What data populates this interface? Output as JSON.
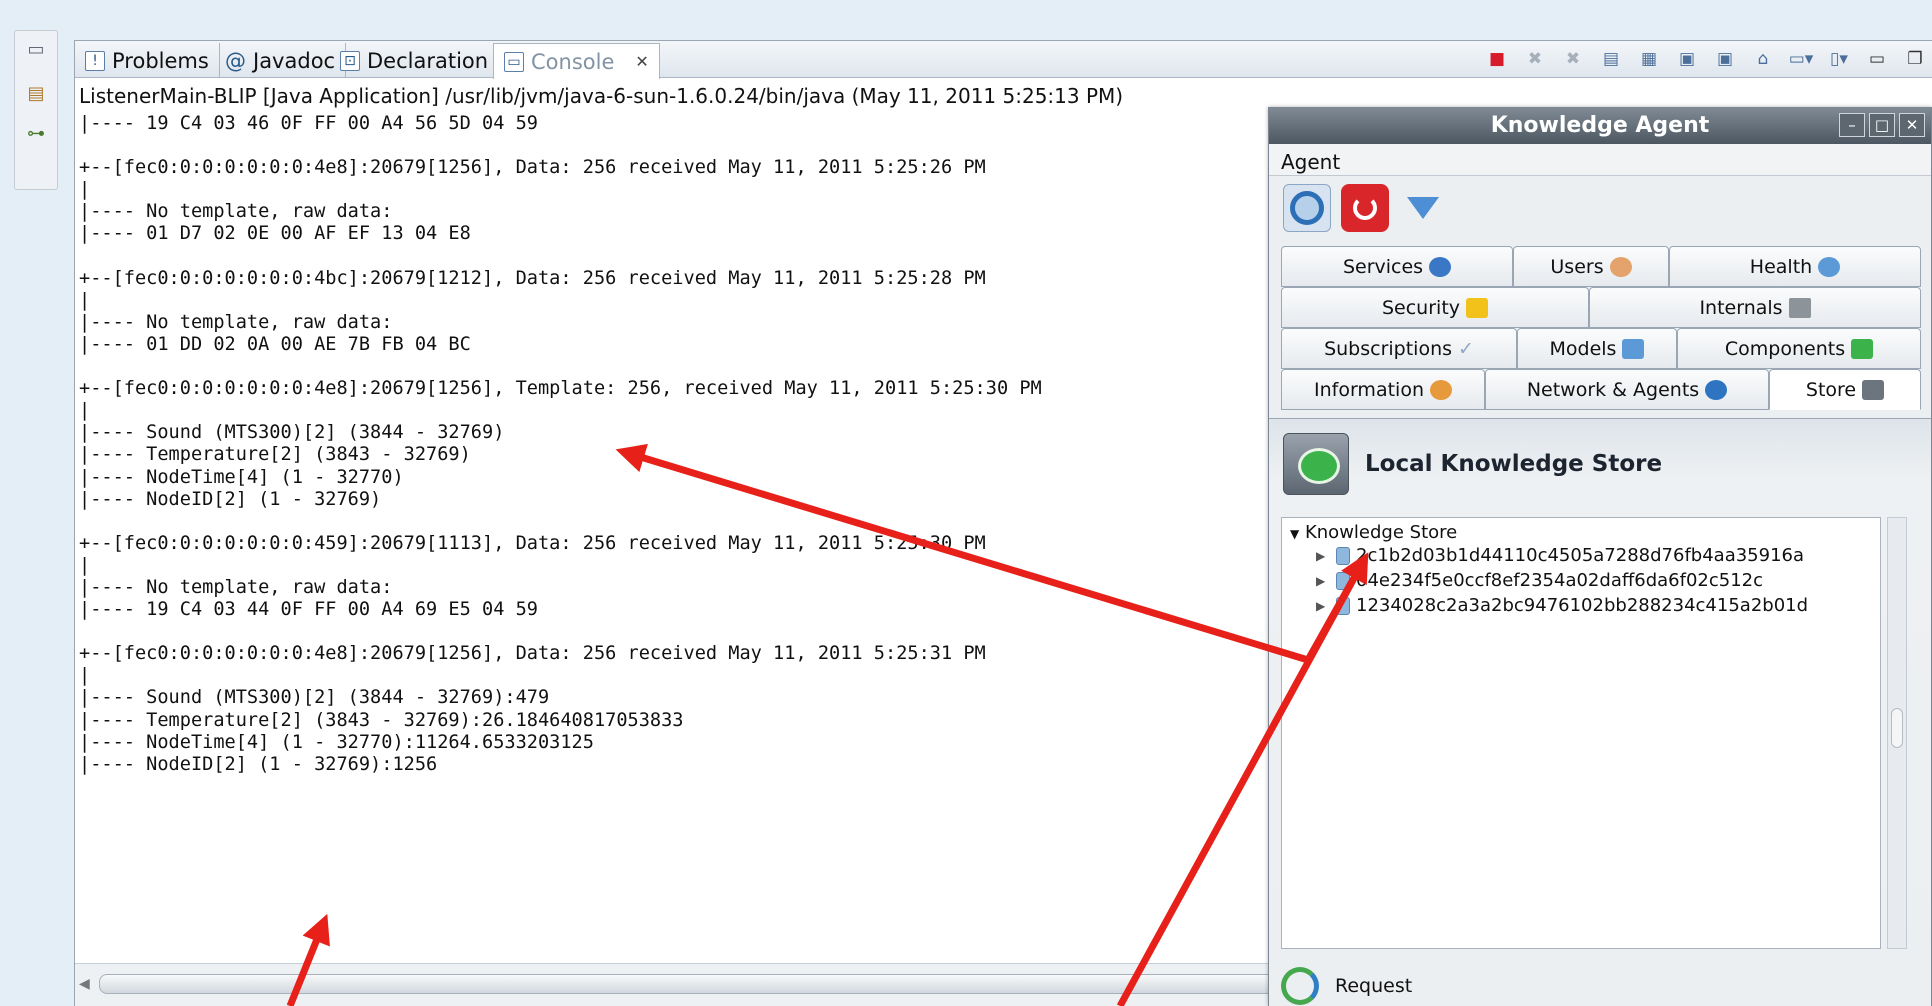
{
  "rail": {
    "icons": [
      "window-icon",
      "package-icon",
      "hierarchy-icon"
    ]
  },
  "tabs": [
    {
      "label": "Problems",
      "icon": "problems-icon"
    },
    {
      "label": "Javadoc",
      "icon": "javadoc-icon"
    },
    {
      "label": "Declaration",
      "icon": "declaration-icon"
    },
    {
      "label": "Console",
      "icon": "console-icon",
      "active": true
    }
  ],
  "toolbar": {
    "icons": [
      "terminate-icon",
      "remove-launch-icon",
      "remove-all-icon",
      "scroll-lock-icon",
      "word-wrap-icon",
      "show-on-output-icon",
      "show-on-error-icon",
      "pin-console-icon",
      "display-console-icon",
      "open-console-icon",
      "minimize-icon",
      "maximize-icon"
    ]
  },
  "console": {
    "process": "ListenerMain-BLIP [Java Application] /usr/lib/jvm/java-6-sun-1.6.0.24/bin/java (May 11, 2011 5:25:13 PM)",
    "lines": [
      "|---- 19 C4 03 46 0F FF 00 A4 56 5D 04 59",
      "",
      "+--[fec0:0:0:0:0:0:0:4e8]:20679[1256], Data: 256 received May 11, 2011 5:25:26 PM",
      "|",
      "|---- No template, raw data:",
      "|---- 01 D7 02 0E 00 AF EF 13 04 E8",
      "",
      "+--[fec0:0:0:0:0:0:0:4bc]:20679[1212], Data: 256 received May 11, 2011 5:25:28 PM",
      "|",
      "|---- No template, raw data:",
      "|---- 01 DD 02 0A 00 AE 7B FB 04 BC",
      "",
      "+--[fec0:0:0:0:0:0:0:4e8]:20679[1256], Template: 256, received May 11, 2011 5:25:30 PM",
      "|",
      "|---- Sound (MTS300)[2] (3844 - 32769)",
      "|---- Temperature[2] (3843 - 32769)",
      "|---- NodeTime[4] (1 - 32770)",
      "|---- NodeID[2] (1 - 32769)",
      "",
      "+--[fec0:0:0:0:0:0:0:459]:20679[1113], Data: 256 received May 11, 2011 5:25:30 PM",
      "|",
      "|---- No template, raw data:",
      "|---- 19 C4 03 44 0F FF 00 A4 69 E5 04 59",
      "",
      "+--[fec0:0:0:0:0:0:0:4e8]:20679[1256], Data: 256 received May 11, 2011 5:25:31 PM",
      "|",
      "|---- Sound (MTS300)[2] (3844 - 32769):479",
      "|---- Temperature[2] (3843 - 32769):26.184640817053833",
      "|---- NodeTime[4] (1 - 32770):11264.6533203125",
      "|---- NodeID[2] (1 - 32769):1256"
    ]
  },
  "agent": {
    "title": "Knowledge Agent",
    "menu": "Agent",
    "tools": [
      "gear-icon",
      "power-icon",
      "download-icon"
    ],
    "tab_rows": [
      [
        "Services",
        "Users",
        "Health"
      ],
      [
        "Security",
        "Internals"
      ],
      [
        "Subscriptions",
        "Models",
        "Components"
      ],
      [
        "Information",
        "Network & Agents",
        "Store"
      ]
    ],
    "selected_tab": "Store",
    "panel_title": "Local Knowledge Store",
    "tree_root": "Knowledge Store",
    "tree_items": [
      "2c1b2d03b1d44110c4505a7288d76fb4aa35916a",
      "04e234f5e0ccf8ef2354a02daff6da6f02c512c",
      "1234028c2a3a2bc9476102bb288234c415a2b01d"
    ],
    "request_label": "Request"
  },
  "annotations": {
    "arrow_color": "#e8201a"
  }
}
